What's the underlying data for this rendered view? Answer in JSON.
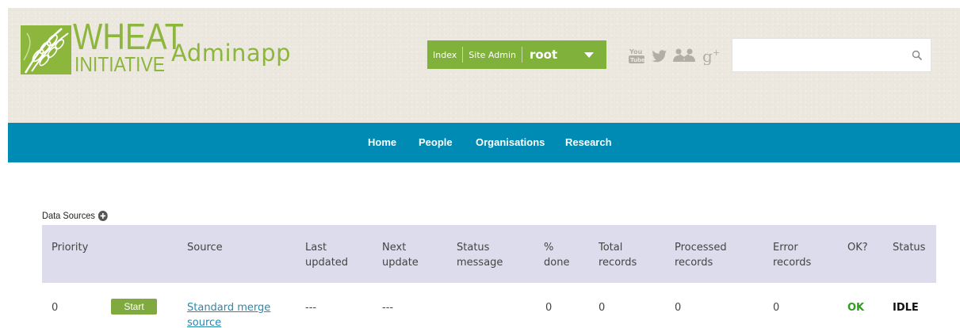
{
  "header": {
    "logo_wheat": "WHEAT",
    "logo_initiative": "INITIATIVE",
    "app_title": "Adminapp",
    "admin_bar": {
      "index_label": "Index",
      "site_admin_label": "Site Admin",
      "user": "root"
    },
    "social_icons": [
      "youtube-icon",
      "twitter-icon",
      "social-people-icon",
      "google-plus-icon"
    ],
    "search": {
      "value": "",
      "placeholder": ""
    }
  },
  "nav": {
    "items": [
      {
        "label": "Home"
      },
      {
        "label": "People"
      },
      {
        "label": "Organisations"
      },
      {
        "label": "Research"
      }
    ]
  },
  "data_sources": {
    "title": "Data Sources",
    "columns": [
      "Priority",
      "Source",
      "Last updated",
      "Next update",
      "Status message",
      "% done",
      "Total records",
      "Processed records",
      "Error records",
      "OK?",
      "Status"
    ],
    "rows": [
      {
        "priority": "0",
        "action_label": "Start",
        "source": "Standard merge source",
        "last_updated": "---",
        "next_update": "---",
        "status_message": "",
        "percent_done": "0",
        "total_records": "0",
        "processed_records": "0",
        "error_records": "0",
        "ok": "OK",
        "status": "IDLE"
      }
    ]
  },
  "colors": {
    "brand_green": "#8db63c",
    "admin_bar_green": "#7fb13b",
    "nav_blue": "#008bb4",
    "table_header": "#dddced",
    "ok_green": "#2f9d1e",
    "link_blue": "#2a88ad"
  }
}
